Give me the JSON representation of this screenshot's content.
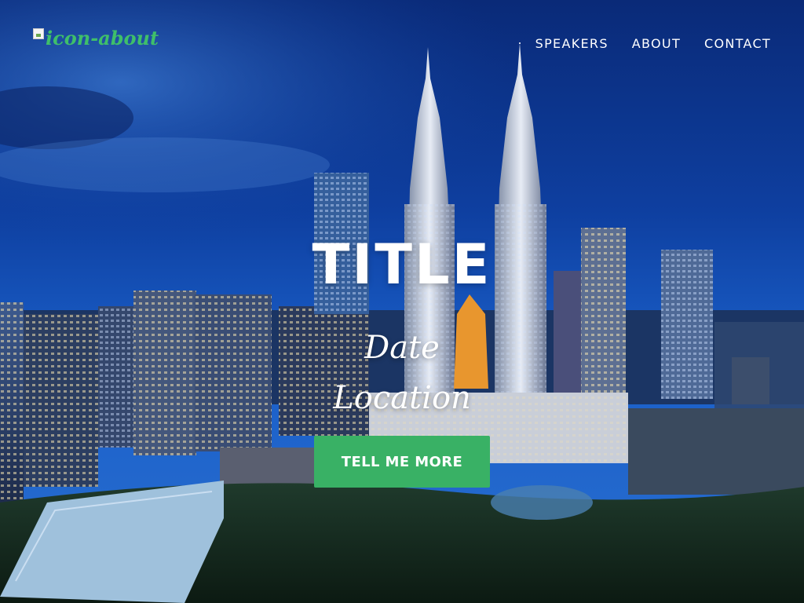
{
  "brand": {
    "alt_text": "icon-about",
    "color": "#3fbf6a"
  },
  "nav": {
    "items": [
      {
        "label": "SPEAKERS"
      },
      {
        "label": "ABOUT"
      },
      {
        "label": "CONTACT"
      }
    ]
  },
  "hero": {
    "title": "TITLE",
    "date": "Date",
    "location": "Location",
    "cta_label": "TELL ME MORE",
    "cta_color": "#39b165",
    "background": {
      "scene": "city skyline with twin towers at dusk",
      "sky_color": "#0e3fa0"
    }
  }
}
